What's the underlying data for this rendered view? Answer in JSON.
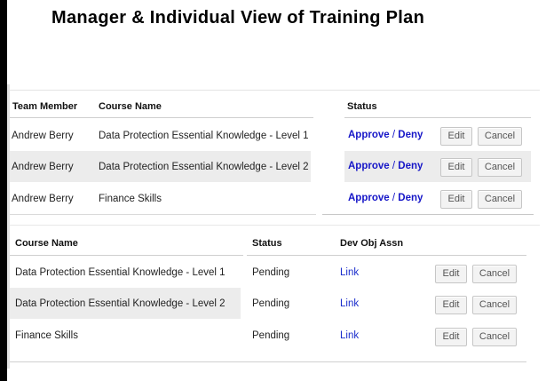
{
  "title": "Manager & Individual View of Training Plan",
  "manager_view": {
    "headers": {
      "team_member": "Team Member",
      "course_name": "Course Name",
      "status": "Status"
    },
    "rows": [
      {
        "team_member": "Andrew Berry",
        "course_name": "Data Protection Essential Knowledge - Level 1",
        "approve": "Approve",
        "sep": "/",
        "deny": "Deny",
        "edit": "Edit",
        "cancel": "Cancel"
      },
      {
        "team_member": "Andrew Berry",
        "course_name": "Data Protection Essential Knowledge - Level 2",
        "approve": "Approve",
        "sep": "/",
        "deny": "Deny",
        "edit": "Edit",
        "cancel": "Cancel"
      },
      {
        "team_member": "Andrew Berry",
        "course_name": "Finance Skills",
        "approve": "Approve",
        "sep": "/",
        "deny": "Deny",
        "edit": "Edit",
        "cancel": "Cancel"
      }
    ]
  },
  "individual_view": {
    "headers": {
      "course_name": "Course Name",
      "status": "Status",
      "dev_obj": "Dev Obj Assn"
    },
    "rows": [
      {
        "course_name": "Data Protection Essential Knowledge - Level 1",
        "status": "Pending",
        "link": "Link",
        "edit": "Edit",
        "cancel": "Cancel"
      },
      {
        "course_name": "Data Protection Essential Knowledge - Level 2",
        "status": "Pending",
        "link": "Link",
        "edit": "Edit",
        "cancel": "Cancel"
      },
      {
        "course_name": "Finance Skills",
        "status": "Pending",
        "link": "Link",
        "edit": "Edit",
        "cancel": "Cancel"
      }
    ]
  }
}
